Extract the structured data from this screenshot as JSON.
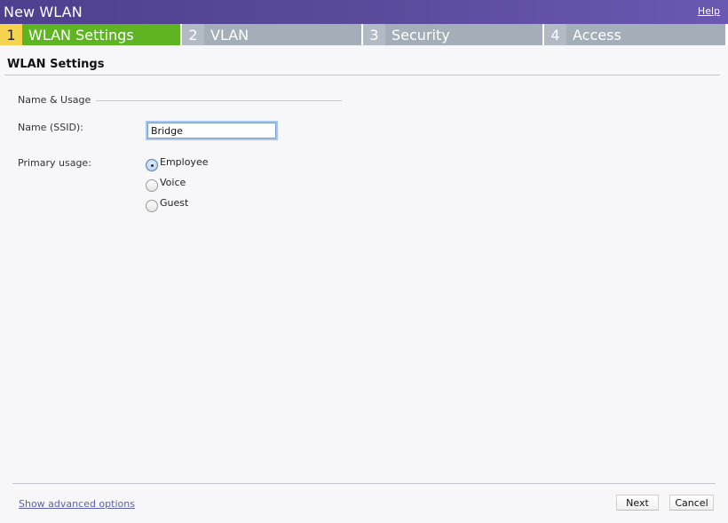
{
  "window": {
    "title": "New WLAN",
    "help_label": "Help"
  },
  "wizard": {
    "active_step": 1,
    "steps": [
      {
        "number": "1",
        "label": "WLAN Settings"
      },
      {
        "number": "2",
        "label": "VLAN"
      },
      {
        "number": "3",
        "label": "Security"
      },
      {
        "number": "4",
        "label": "Access"
      }
    ]
  },
  "section": {
    "title": "WLAN Settings",
    "fieldset_legend": "Name & Usage"
  },
  "form": {
    "ssid_label": "Name (SSID):",
    "ssid_value": "Bridge",
    "usage_label": "Primary usage:",
    "usage_options": [
      {
        "label": "Employee",
        "checked": true
      },
      {
        "label": "Voice",
        "checked": false
      },
      {
        "label": "Guest",
        "checked": false
      }
    ]
  },
  "footer": {
    "advanced_link": "Show advanced options",
    "next_label": "Next",
    "cancel_label": "Cancel"
  },
  "colors": {
    "titlebar": "#5a4a9a",
    "active_step": "#5eb521",
    "active_step_number": "#f6d34e",
    "inactive_step": "#a4aeb8",
    "link": "#5a5fb0"
  }
}
